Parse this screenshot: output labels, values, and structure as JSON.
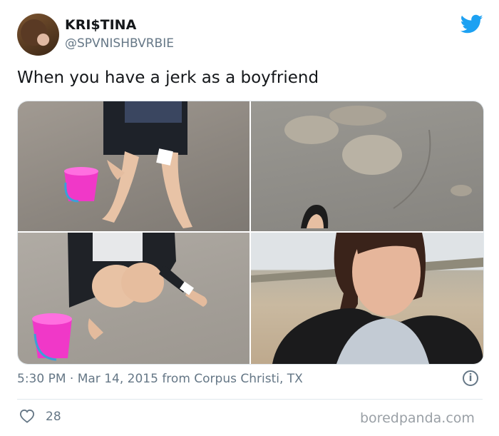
{
  "author": {
    "name": "KRI$TINA",
    "handle": "@SPVNISHBVRBIE"
  },
  "tweet": {
    "text": "When you have a jerk as a boyfriend"
  },
  "meta": {
    "time": "5:30 PM",
    "separator": "·",
    "date": "Mar 14, 2015",
    "location": "from Corpus Christi, TX"
  },
  "engagement": {
    "likes": "28"
  },
  "icons": {
    "brand": "twitter-bird-icon",
    "info": "info-icon",
    "like": "heart-icon"
  },
  "colors": {
    "brand_blue": "#1da1f2",
    "text": "#14171a",
    "secondary": "#657786",
    "bucket_pink": "#f038c8"
  },
  "watermark": "boredpanda.com"
}
